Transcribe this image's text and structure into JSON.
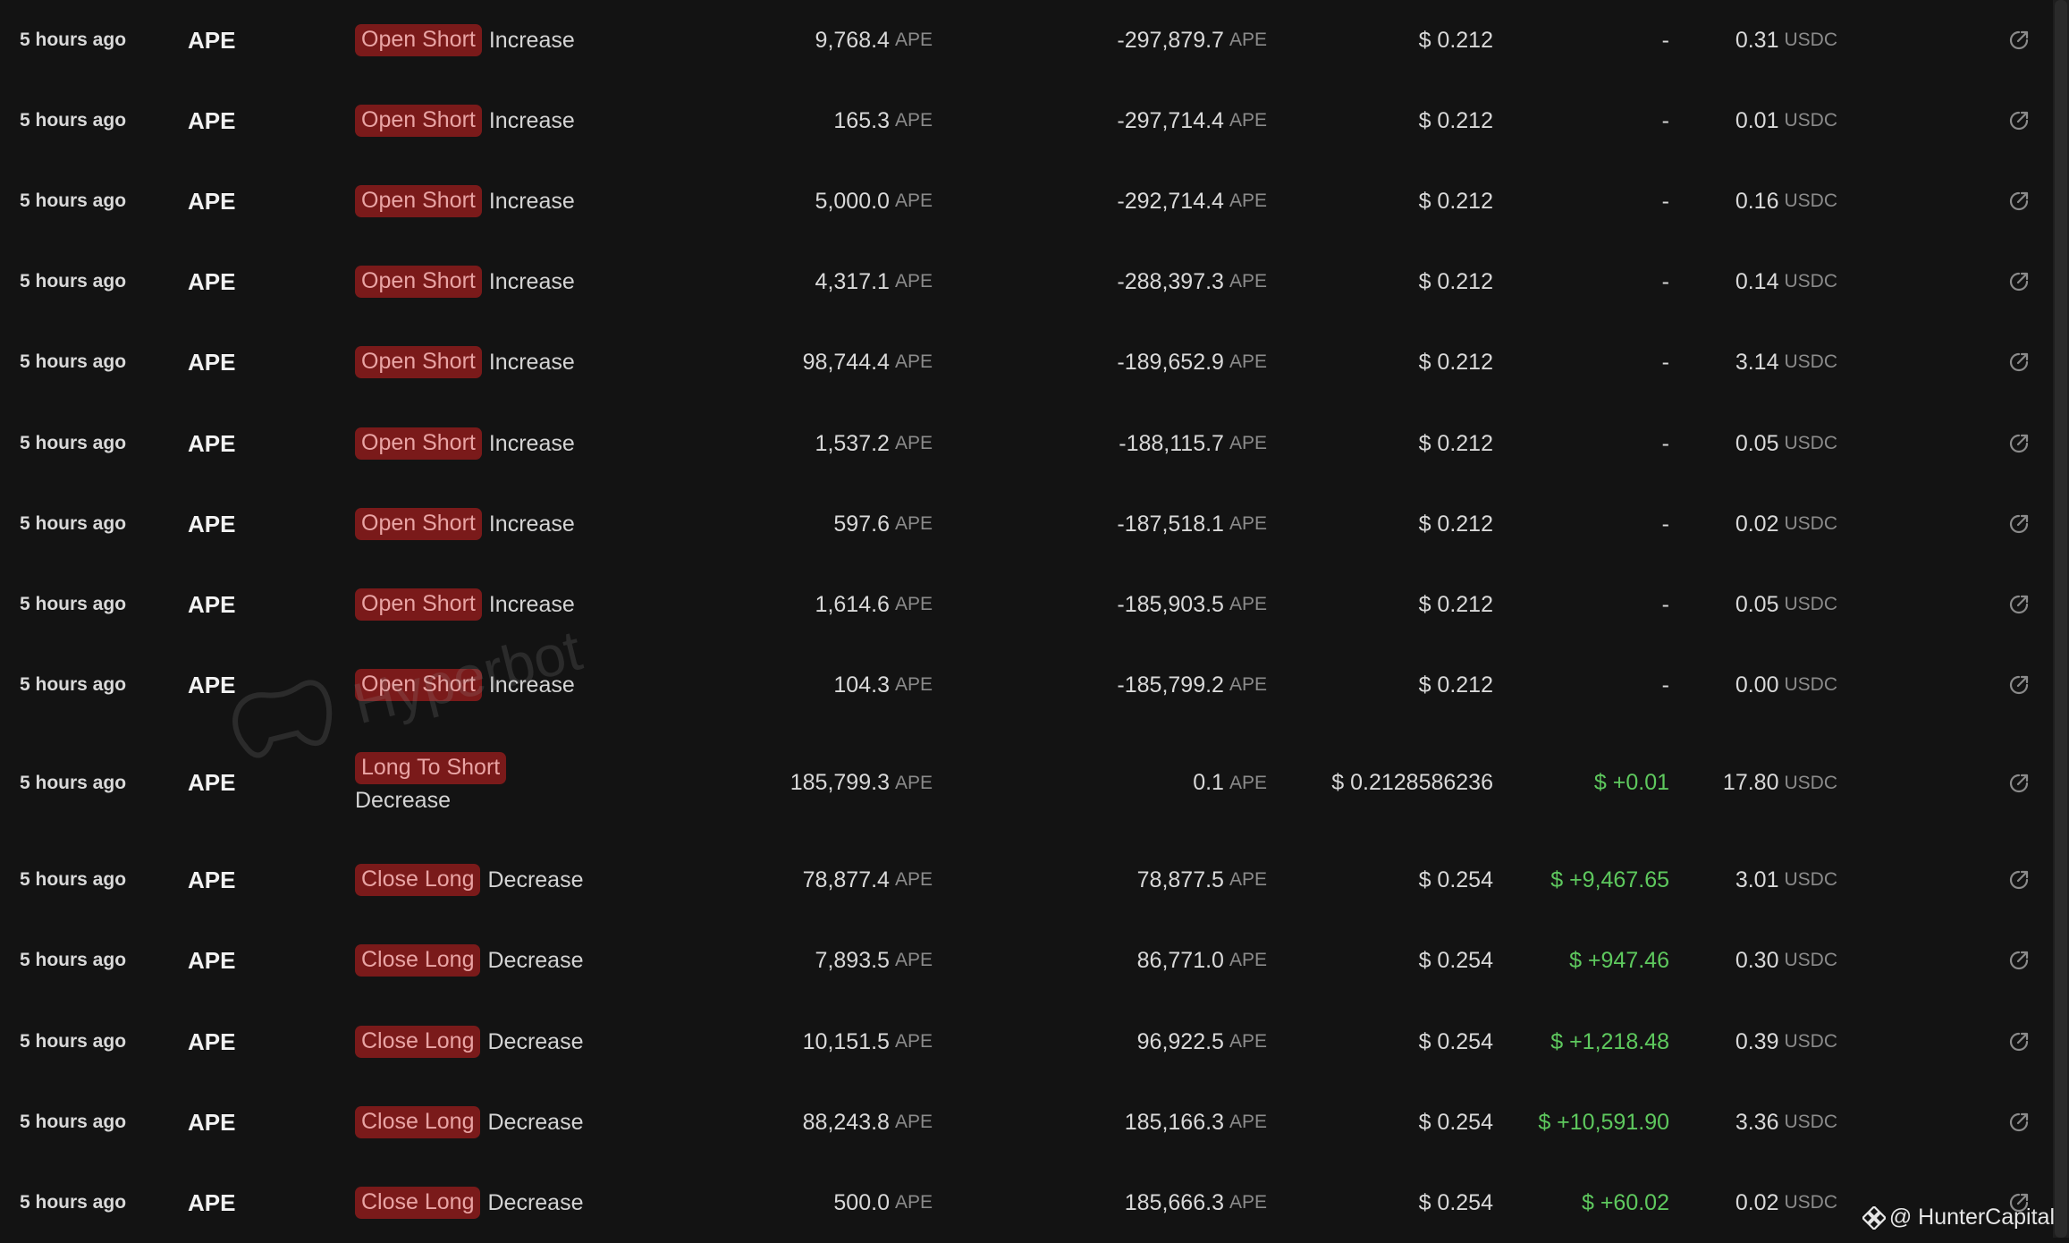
{
  "colors": {
    "background": "#131313",
    "badge_bg": "#7a1a1a",
    "badge_text": "#e9a4a4",
    "profit_green": "#5ec95e",
    "muted_unit": "#8b8b8b"
  },
  "watermark": {
    "text": "Hyperbot"
  },
  "credit": {
    "text": "@ HunterCapital",
    "icon": "binance-icon"
  },
  "rows": [
    {
      "time": "5 hours ago",
      "token": "APE",
      "action": "Open Short",
      "direction": "Increase",
      "amount": "9,768.4",
      "amount_unit": "APE",
      "position": "-297,879.7",
      "position_unit": "APE",
      "price": "$ 0.212",
      "pnl": "-",
      "fee": "0.31",
      "fee_unit": "USDC"
    },
    {
      "time": "5 hours ago",
      "token": "APE",
      "action": "Open Short",
      "direction": "Increase",
      "amount": "165.3",
      "amount_unit": "APE",
      "position": "-297,714.4",
      "position_unit": "APE",
      "price": "$ 0.212",
      "pnl": "-",
      "fee": "0.01",
      "fee_unit": "USDC"
    },
    {
      "time": "5 hours ago",
      "token": "APE",
      "action": "Open Short",
      "direction": "Increase",
      "amount": "5,000.0",
      "amount_unit": "APE",
      "position": "-292,714.4",
      "position_unit": "APE",
      "price": "$ 0.212",
      "pnl": "-",
      "fee": "0.16",
      "fee_unit": "USDC"
    },
    {
      "time": "5 hours ago",
      "token": "APE",
      "action": "Open Short",
      "direction": "Increase",
      "amount": "4,317.1",
      "amount_unit": "APE",
      "position": "-288,397.3",
      "position_unit": "APE",
      "price": "$ 0.212",
      "pnl": "-",
      "fee": "0.14",
      "fee_unit": "USDC"
    },
    {
      "time": "5 hours ago",
      "token": "APE",
      "action": "Open Short",
      "direction": "Increase",
      "amount": "98,744.4",
      "amount_unit": "APE",
      "position": "-189,652.9",
      "position_unit": "APE",
      "price": "$ 0.212",
      "pnl": "-",
      "fee": "3.14",
      "fee_unit": "USDC"
    },
    {
      "time": "5 hours ago",
      "token": "APE",
      "action": "Open Short",
      "direction": "Increase",
      "amount": "1,537.2",
      "amount_unit": "APE",
      "position": "-188,115.7",
      "position_unit": "APE",
      "price": "$ 0.212",
      "pnl": "-",
      "fee": "0.05",
      "fee_unit": "USDC"
    },
    {
      "time": "5 hours ago",
      "token": "APE",
      "action": "Open Short",
      "direction": "Increase",
      "amount": "597.6",
      "amount_unit": "APE",
      "position": "-187,518.1",
      "position_unit": "APE",
      "price": "$ 0.212",
      "pnl": "-",
      "fee": "0.02",
      "fee_unit": "USDC"
    },
    {
      "time": "5 hours ago",
      "token": "APE",
      "action": "Open Short",
      "direction": "Increase",
      "amount": "1,614.6",
      "amount_unit": "APE",
      "position": "-185,903.5",
      "position_unit": "APE",
      "price": "$ 0.212",
      "pnl": "-",
      "fee": "0.05",
      "fee_unit": "USDC"
    },
    {
      "time": "5 hours ago",
      "token": "APE",
      "action": "Open Short",
      "direction": "Increase",
      "amount": "104.3",
      "amount_unit": "APE",
      "position": "-185,799.2",
      "position_unit": "APE",
      "price": "$ 0.212",
      "pnl": "-",
      "fee": "0.00",
      "fee_unit": "USDC"
    },
    {
      "time": "5 hours ago",
      "token": "APE",
      "action": "Long To Short",
      "direction": "Decrease",
      "amount": "185,799.3",
      "amount_unit": "APE",
      "position": "0.1",
      "position_unit": "APE",
      "price": "$ 0.2128586236",
      "pnl": "$ +0.01",
      "fee": "17.80",
      "fee_unit": "USDC"
    },
    {
      "time": "5 hours ago",
      "token": "APE",
      "action": "Close Long",
      "direction": "Decrease",
      "amount": "78,877.4",
      "amount_unit": "APE",
      "position": "78,877.5",
      "position_unit": "APE",
      "price": "$ 0.254",
      "pnl": "$ +9,467.65",
      "fee": "3.01",
      "fee_unit": "USDC"
    },
    {
      "time": "5 hours ago",
      "token": "APE",
      "action": "Close Long",
      "direction": "Decrease",
      "amount": "7,893.5",
      "amount_unit": "APE",
      "position": "86,771.0",
      "position_unit": "APE",
      "price": "$ 0.254",
      "pnl": "$ +947.46",
      "fee": "0.30",
      "fee_unit": "USDC"
    },
    {
      "time": "5 hours ago",
      "token": "APE",
      "action": "Close Long",
      "direction": "Decrease",
      "amount": "10,151.5",
      "amount_unit": "APE",
      "position": "96,922.5",
      "position_unit": "APE",
      "price": "$ 0.254",
      "pnl": "$ +1,218.48",
      "fee": "0.39",
      "fee_unit": "USDC"
    },
    {
      "time": "5 hours ago",
      "token": "APE",
      "action": "Close Long",
      "direction": "Decrease",
      "amount": "88,243.8",
      "amount_unit": "APE",
      "position": "185,166.3",
      "position_unit": "APE",
      "price": "$ 0.254",
      "pnl": "$ +10,591.90",
      "fee": "3.36",
      "fee_unit": "USDC"
    },
    {
      "time": "5 hours ago",
      "token": "APE",
      "action": "Close Long",
      "direction": "Decrease",
      "amount": "500.0",
      "amount_unit": "APE",
      "position": "185,666.3",
      "position_unit": "APE",
      "price": "$ 0.254",
      "pnl": "$ +60.02",
      "fee": "0.02",
      "fee_unit": "USDC"
    }
  ]
}
